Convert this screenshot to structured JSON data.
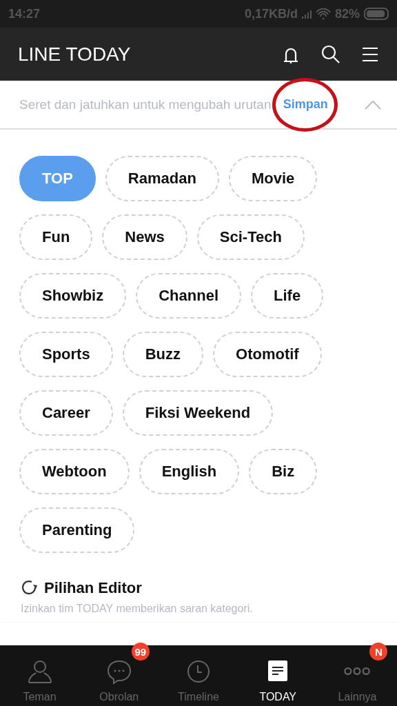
{
  "status_bar": {
    "time": "14:27",
    "network_speed": "0,17KB/d",
    "battery": "82%"
  },
  "header": {
    "title": "LINE TODAY"
  },
  "edit_bar": {
    "hint": "Seret dan jatuhkan untuk mengubah urutan.",
    "save": "Simpan",
    "expanded": true
  },
  "categories": [
    {
      "label": "TOP",
      "selected": true
    },
    {
      "label": "Ramadan",
      "selected": false
    },
    {
      "label": "Movie",
      "selected": false
    },
    {
      "label": "Fun",
      "selected": false
    },
    {
      "label": "News",
      "selected": false
    },
    {
      "label": "Sci-Tech",
      "selected": false
    },
    {
      "label": "Showbiz",
      "selected": false
    },
    {
      "label": "Channel",
      "selected": false
    },
    {
      "label": "Life",
      "selected": false
    },
    {
      "label": "Sports",
      "selected": false
    },
    {
      "label": "Buzz",
      "selected": false
    },
    {
      "label": "Otomotif",
      "selected": false
    },
    {
      "label": "Career",
      "selected": false
    },
    {
      "label": "Fiksi Weekend",
      "selected": false
    },
    {
      "label": "Webtoon",
      "selected": false
    },
    {
      "label": "English",
      "selected": false
    },
    {
      "label": "Biz",
      "selected": false
    },
    {
      "label": "Parenting",
      "selected": false
    }
  ],
  "editor_pick": {
    "title": "Pilihan Editor",
    "description": "Izinkan tim TODAY memberikan saran kategori."
  },
  "tab_bar": [
    {
      "kind": "person",
      "label": "Teman",
      "selected": false
    },
    {
      "kind": "chat",
      "label": "Obrolan",
      "selected": false,
      "badge": "99"
    },
    {
      "kind": "clock",
      "label": "Timeline",
      "selected": false
    },
    {
      "kind": "news",
      "label": "TODAY",
      "selected": true
    },
    {
      "kind": "more",
      "label": "Lainnya",
      "selected": false,
      "badge": "N"
    }
  ]
}
